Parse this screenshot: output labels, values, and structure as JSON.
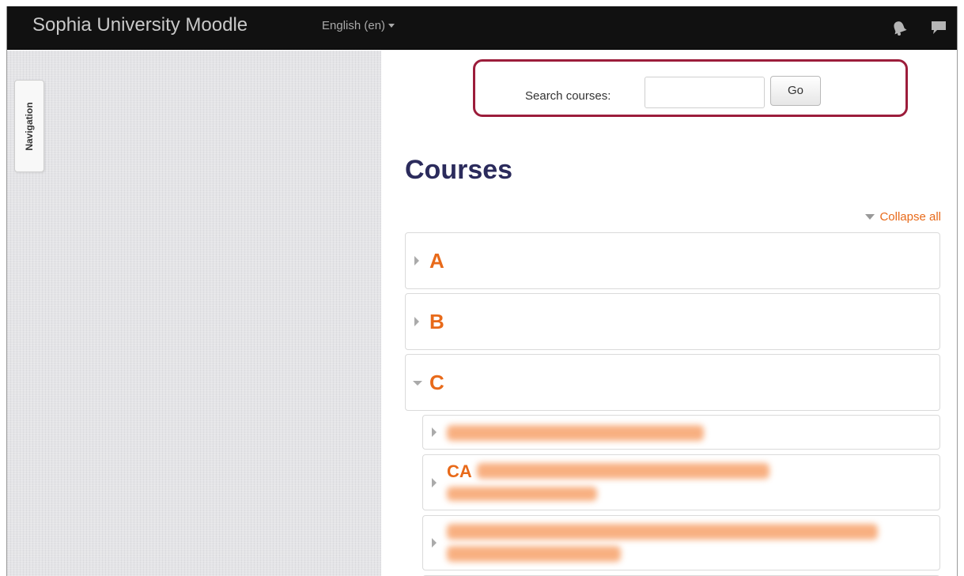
{
  "navbar": {
    "brand": "Sophia University Moodle",
    "language": "English (en)",
    "bg_color": "#111111"
  },
  "sidebar": {
    "navigation_tab_label": "Navigation"
  },
  "search": {
    "label": "Search courses:",
    "input_value": "",
    "button_label": "Go",
    "highlight_color": "#9c1d3b"
  },
  "courses": {
    "title": "Courses",
    "collapse_all_label": "Collapse all",
    "categories": [
      {
        "letter": "A",
        "expanded": false
      },
      {
        "letter": "B",
        "expanded": false
      },
      {
        "letter": "C",
        "expanded": true
      }
    ],
    "subcategory_visible_text": "CA",
    "accent_color": "#e86a1a"
  },
  "icons": [
    "bell-icon",
    "chat-icon",
    "caret-down-icon",
    "triangle-right-icon",
    "triangle-down-icon"
  ]
}
